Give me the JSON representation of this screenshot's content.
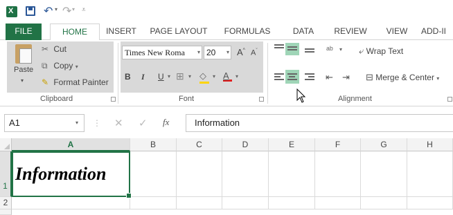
{
  "quick_access": {
    "icons": [
      "excel-icon",
      "save-icon",
      "undo-icon",
      "redo-icon",
      "customize-icon"
    ],
    "undo_glyph": "↶",
    "redo_glyph": "↷"
  },
  "tabs": {
    "file": "FILE",
    "home": "HOME",
    "insert": "INSERT",
    "page_layout": "PAGE LAYOUT",
    "formulas": "FORMULAS",
    "data": "DATA",
    "review": "REVIEW",
    "view": "VIEW",
    "addins": "ADD-II"
  },
  "clipboard": {
    "paste": "Paste",
    "cut": "Cut",
    "copy": "Copy",
    "format_painter": "Format Painter",
    "group_label": "Clipboard"
  },
  "font": {
    "font_name": "Times New Roma",
    "font_size": "20",
    "grow": "A",
    "shrink": "A",
    "bold": "B",
    "italic": "I",
    "underline": "U",
    "font_color_letter": "A",
    "group_label": "Font"
  },
  "alignment": {
    "wrap_text": "Wrap Text",
    "merge_center": "Merge & Center",
    "group_label": "Alignment"
  },
  "formula_bar": {
    "name_box": "A1",
    "fx": "fx",
    "value": "Information"
  },
  "grid": {
    "columns": [
      "A",
      "B",
      "C",
      "D",
      "E",
      "F",
      "G",
      "H"
    ],
    "rows": [
      "1",
      "2"
    ],
    "a1_value": "Information"
  },
  "colors": {
    "accent": "#217346",
    "highlight": "#9fd5b7",
    "group_background": "#d9d9d9",
    "fill_yellow": "#ffd400",
    "font_red": "#e02020"
  }
}
